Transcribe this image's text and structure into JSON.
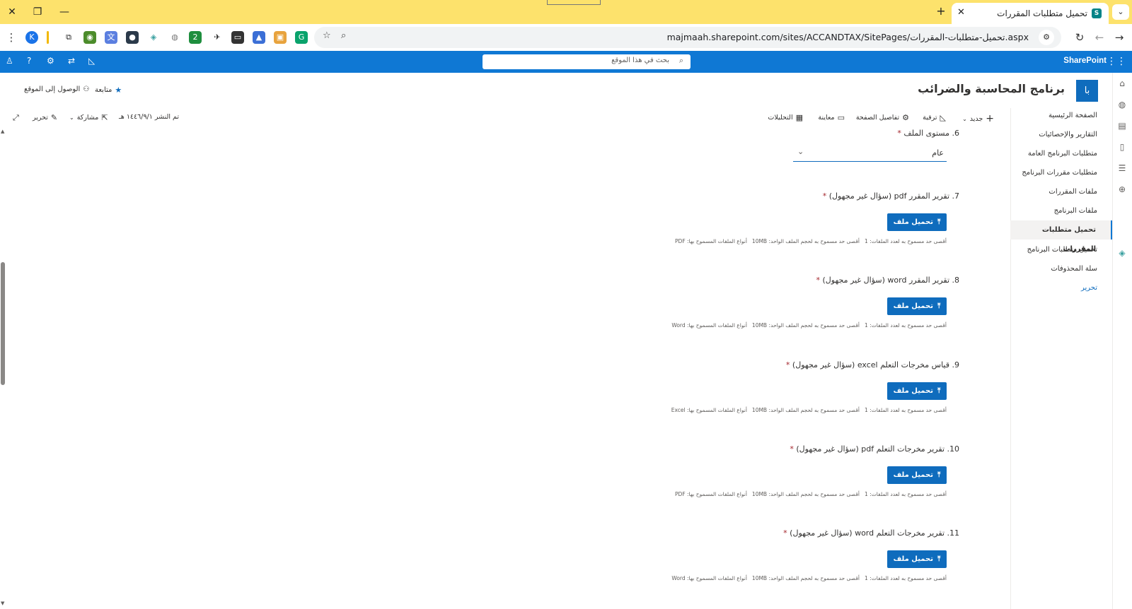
{
  "browser": {
    "tab_title": "تحميل متطلبات المقررات",
    "url": "majmaah.sharepoint.com/sites/ACCANDTAX/SitePages/تحميل-متطلبات-المقررات.aspx"
  },
  "suite": {
    "brand": "SharePoint",
    "search_placeholder": "بحث في هذا الموقع"
  },
  "site": {
    "logo_text": "با",
    "title": "برنامج المحاسبة والضرائب",
    "follow_label": "متابعة",
    "site_access_label": "الوصول إلى الموقع"
  },
  "nav": {
    "items": [
      {
        "label": "الصفحة الرئيسية"
      },
      {
        "label": "التقارير والإحصائيات"
      },
      {
        "label": "متطلبات البرنامج العامة"
      },
      {
        "label": "متطلبات مقررات البرنامج"
      },
      {
        "label": "ملفات المقررات"
      },
      {
        "label": "ملفات البرنامج"
      },
      {
        "label": "تحميل متطلبات المقررات"
      },
      {
        "label": "تحميل متطلبات البرنامج"
      },
      {
        "label": "سلة المحذوفات"
      },
      {
        "label": "تحرير"
      }
    ],
    "active_index": 6
  },
  "commandbar": {
    "new": "جديد",
    "promote": "ترقية",
    "page_details": "تفاصيل الصفحة",
    "preview": "معاينة",
    "analytics": "التحليلات",
    "published": "تم النشر ١٤٤٦/٩/١ هـ",
    "share": "مشاركة",
    "edit": "تحرير"
  },
  "form": {
    "q6": {
      "label": "6. مستوى الملف",
      "value": "عام"
    },
    "upload_label": "تحميل ملف",
    "note_max_files": "أقصى حد مسموح به لعدد الملفات: 1",
    "note_max_size": "أقصى حد مسموح به لحجم الملف الواحد: 10MB",
    "questions": [
      {
        "label": "7. تقرير المقرر pdf (سؤال غير مجهول)",
        "types": "أنواع الملفات المسموح بها: PDF"
      },
      {
        "label": "8. تقرير المقرر word (سؤال غير مجهول)",
        "types": "أنواع الملفات المسموح بها: Word"
      },
      {
        "label": "9. قياس مخرجات التعلم excel (سؤال غير مجهول)",
        "types": "أنواع الملفات المسموح بها: Excel"
      },
      {
        "label": "10. تقرير مخرجات التعلم pdf (سؤال غير مجهول)",
        "types": "أنواع الملفات المسموح بها: PDF"
      },
      {
        "label": "11. تقرير مخرجات التعلم word (سؤال غير مجهول)",
        "types": "أنواع الملفات المسموح بها: Word"
      }
    ]
  },
  "colors": {
    "titlebar": "#fde26c",
    "suitebar": "#0f78d4",
    "primary_button": "#0f6cbd",
    "required": "#a4262c"
  }
}
